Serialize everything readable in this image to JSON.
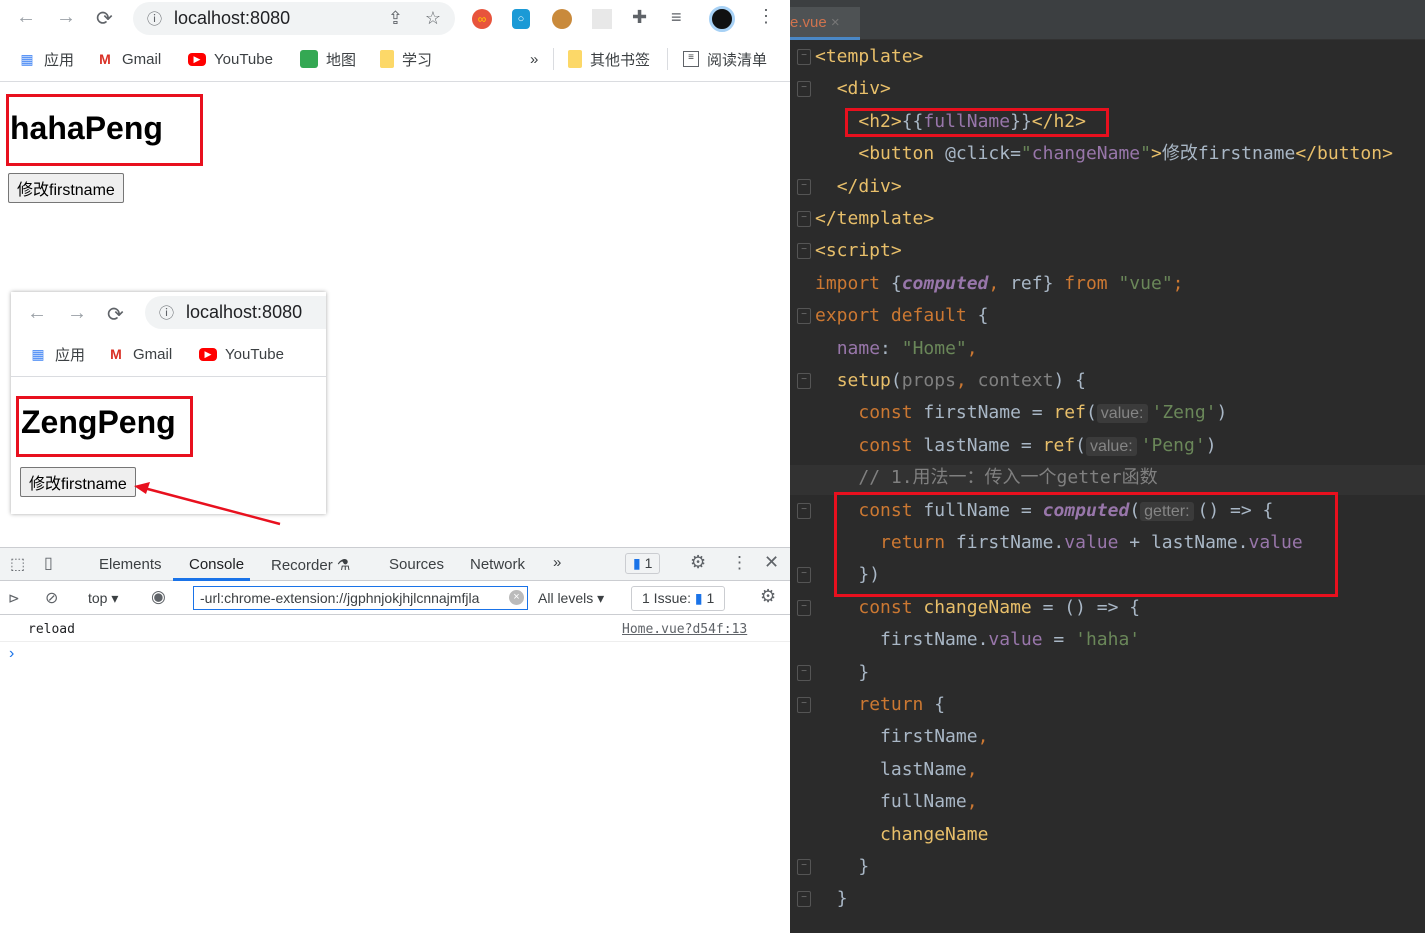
{
  "browser": {
    "url": "localhost:8080",
    "bookmarks": [
      "应用",
      "Gmail",
      "YouTube",
      "地图",
      "学习"
    ],
    "more": "»",
    "other_bookmarks": "其他书签",
    "reading_list": "阅读清单"
  },
  "page": {
    "heading": "hahaPeng",
    "button": "修改firstname"
  },
  "popup": {
    "url": "localhost:8080",
    "bookmarks": [
      "应用",
      "Gmail",
      "YouTube"
    ],
    "heading": "ZengPeng",
    "button": "修改firstname"
  },
  "devtools": {
    "tabs": [
      "Elements",
      "Console",
      "Recorder",
      "Sources",
      "Network"
    ],
    "active_tab": "Console",
    "more": "»",
    "message_badge": "1",
    "context": "top",
    "filter": "-url:chrome-extension://jgphnjokjhjlcnnajmfjla",
    "levels": "All levels",
    "issues": "1 Issue:",
    "issues_count": "1",
    "log": {
      "text": "reload",
      "source": "Home.vue?d54f:13"
    },
    "prompt": "›"
  },
  "editor": {
    "tab": "e.vue",
    "close": "×",
    "lines": [
      [
        [
          "tag",
          "<template>"
        ]
      ],
      [
        [
          "",
          "  "
        ],
        [
          "tag",
          "<div>"
        ]
      ],
      [
        [
          "",
          "    "
        ],
        [
          "tag",
          "<h2>"
        ],
        [
          "",
          "{{"
        ],
        [
          "pur",
          "fullName"
        ],
        [
          "",
          "}}"
        ],
        [
          "tag",
          "</h2>"
        ]
      ],
      [
        [
          "",
          "    "
        ],
        [
          "tag",
          "<button "
        ],
        [
          "",
          "@click="
        ],
        [
          "str",
          "\""
        ],
        [
          "pur",
          "changeName"
        ],
        [
          "str",
          "\""
        ],
        [
          "tag",
          ">"
        ],
        [
          "",
          "修改firstname"
        ],
        [
          "tag",
          "</button>"
        ]
      ],
      [
        [
          "",
          "  "
        ],
        [
          "tag",
          "</div>"
        ]
      ],
      [
        [
          "tag",
          "</template>"
        ]
      ],
      [
        [
          "tag",
          "<script>"
        ]
      ],
      [
        [
          "kw",
          "import "
        ],
        [
          "",
          "{"
        ],
        [
          "it",
          "computed"
        ],
        [
          "kw",
          ", "
        ],
        [
          "",
          "ref} "
        ],
        [
          "kw",
          "from "
        ],
        [
          "str",
          "\"vue\""
        ],
        [
          "kw",
          ";"
        ]
      ],
      [
        [
          "kw",
          "export default "
        ],
        [
          "",
          "{"
        ]
      ],
      [
        [
          "",
          "  "
        ],
        [
          "pur",
          "name"
        ],
        [
          "",
          ": "
        ],
        [
          "str",
          "\"Home\""
        ],
        [
          "kw",
          ","
        ]
      ],
      [
        [
          "",
          "  "
        ],
        [
          "tag",
          "setup"
        ],
        [
          "",
          "("
        ],
        [
          "cm",
          "props"
        ],
        [
          "kw",
          ", "
        ],
        [
          "cm",
          "context"
        ],
        [
          "",
          ") {"
        ]
      ],
      [
        [
          "",
          "    "
        ],
        [
          "kw",
          "const "
        ],
        [
          "",
          "firstName = "
        ],
        [
          "tag",
          "ref"
        ],
        [
          "",
          "("
        ],
        [
          "hint",
          "value:"
        ],
        [
          "str",
          "'Zeng'"
        ],
        [
          "",
          ")"
        ]
      ],
      [
        [
          "",
          "    "
        ],
        [
          "kw",
          "const "
        ],
        [
          "",
          "lastName = "
        ],
        [
          "tag",
          "ref"
        ],
        [
          "",
          "("
        ],
        [
          "hint",
          "value:"
        ],
        [
          "str",
          "'Peng'"
        ],
        [
          "",
          ")"
        ]
      ],
      [
        [
          "",
          "    "
        ],
        [
          "cm",
          "// 1.用法一：传入一个getter函数"
        ]
      ],
      [
        [
          "",
          "    "
        ],
        [
          "kw",
          "const "
        ],
        [
          "",
          "fullName = "
        ],
        [
          "it",
          "computed"
        ],
        [
          "",
          "("
        ],
        [
          "hint",
          "getter:"
        ],
        [
          "",
          "() => {"
        ]
      ],
      [
        [
          "",
          "      "
        ],
        [
          "kw",
          "return "
        ],
        [
          "",
          "firstName."
        ],
        [
          "pur",
          "value"
        ],
        [
          "",
          " + lastName."
        ],
        [
          "pur",
          "value"
        ]
      ],
      [
        [
          "",
          "    "
        ],
        [
          "",
          "})"
        ]
      ],
      [
        [
          "",
          "    "
        ],
        [
          "kw",
          "const "
        ],
        [
          "tag",
          "changeName"
        ],
        [
          "",
          " = () => {"
        ]
      ],
      [
        [
          "",
          "      "
        ],
        [
          "",
          "firstName."
        ],
        [
          "pur",
          "value"
        ],
        [
          "",
          " = "
        ],
        [
          "str",
          "'haha'"
        ]
      ],
      [
        [
          "",
          "    "
        ],
        [
          "",
          "}"
        ]
      ],
      [
        [
          "",
          "    "
        ],
        [
          "kw",
          "return "
        ],
        [
          "",
          "{"
        ]
      ],
      [
        [
          "",
          "      "
        ],
        [
          "",
          "firstName"
        ],
        [
          "kw",
          ","
        ]
      ],
      [
        [
          "",
          "      "
        ],
        [
          "",
          "lastName"
        ],
        [
          "kw",
          ","
        ]
      ],
      [
        [
          "",
          "      "
        ],
        [
          "",
          "fullName"
        ],
        [
          "kw",
          ","
        ]
      ],
      [
        [
          "",
          "      "
        ],
        [
          "tag",
          "changeName"
        ]
      ],
      [
        [
          "",
          "    "
        ],
        [
          "",
          "}"
        ]
      ],
      [
        [
          "",
          "  "
        ],
        [
          "",
          "}"
        ]
      ]
    ]
  },
  "colors": {
    "highlight_box": "#e8101e",
    "ide_bg": "#2b2b2b",
    "accent": "#1a73e8"
  }
}
